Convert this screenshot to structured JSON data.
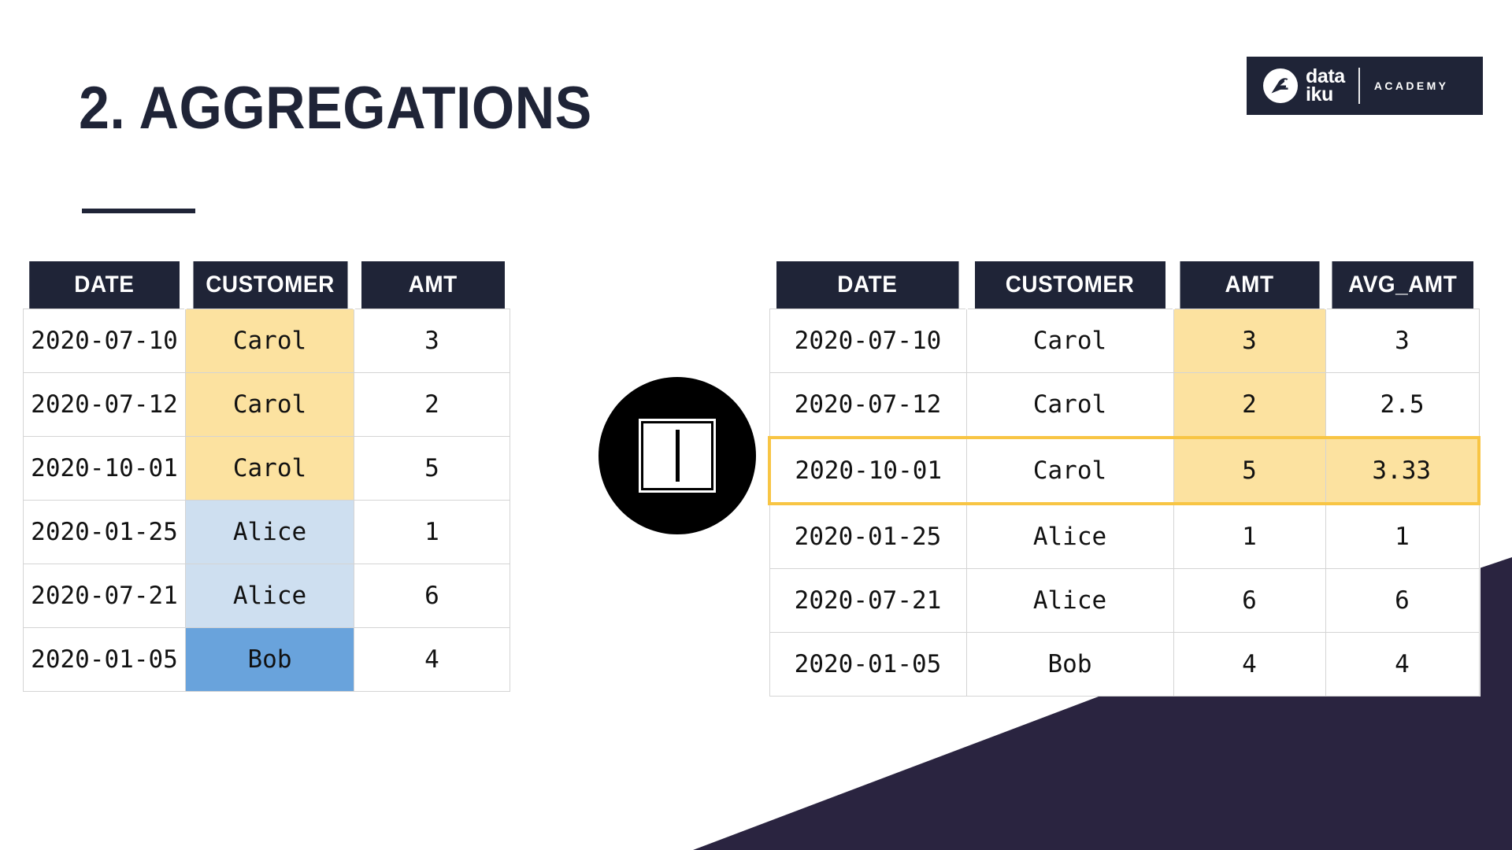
{
  "slide": {
    "title": "2. AGGREGATIONS",
    "background_color": "#FFFFFF"
  },
  "brand": {
    "name_line1": "data",
    "name_line2": "iku",
    "sub_label": "ACADEMY",
    "block_color": "#1F2437",
    "text_color": "#FFFFFF"
  },
  "colors": {
    "navy": "#1F2437",
    "yellow_fill": "#FCE2A0",
    "yellow_outline": "#F8C544",
    "blue_light": "#CEDFF0",
    "blue_mid": "#69A3DC",
    "grid_line": "#D4D4D4",
    "wedge": "#2A2440"
  },
  "center_icon": {
    "semantic": "split-columns-icon",
    "circle_color": "#000000",
    "glyph_color": "#FFFFFF"
  },
  "table_left": {
    "name": "input-table",
    "columns": [
      "DATE",
      "CUSTOMER",
      "AMT"
    ],
    "rows": [
      {
        "cells": [
          "2020-07-10",
          "Carol",
          "3"
        ],
        "fills": [
          "",
          "yellow",
          ""
        ]
      },
      {
        "cells": [
          "2020-07-12",
          "Carol",
          "2"
        ],
        "fills": [
          "",
          "yellow",
          ""
        ]
      },
      {
        "cells": [
          "2020-10-01",
          "Carol",
          "5"
        ],
        "fills": [
          "",
          "yellow",
          ""
        ]
      },
      {
        "cells": [
          "2020-01-25",
          "Alice",
          "1"
        ],
        "fills": [
          "",
          "blue-light",
          ""
        ]
      },
      {
        "cells": [
          "2020-07-21",
          "Alice",
          "6"
        ],
        "fills": [
          "",
          "blue-light",
          ""
        ]
      },
      {
        "cells": [
          "2020-01-05",
          "Bob",
          "4"
        ],
        "fills": [
          "",
          "blue-mid",
          ""
        ]
      }
    ]
  },
  "table_right": {
    "name": "output-table",
    "columns": [
      "DATE",
      "CUSTOMER",
      "AMT",
      "AVG_AMT"
    ],
    "highlight_row_index": 2,
    "rows": [
      {
        "cells": [
          "2020-07-10",
          "Carol",
          "3",
          "3"
        ],
        "fills": [
          "",
          "",
          "yellow",
          ""
        ]
      },
      {
        "cells": [
          "2020-07-12",
          "Carol",
          "2",
          "2.5"
        ],
        "fills": [
          "",
          "",
          "yellow",
          ""
        ]
      },
      {
        "cells": [
          "2020-10-01",
          "Carol",
          "5",
          "3.33"
        ],
        "fills": [
          "",
          "",
          "yellow",
          "yellow"
        ]
      },
      {
        "cells": [
          "2020-01-25",
          "Alice",
          "1",
          "1"
        ],
        "fills": [
          "",
          "",
          "",
          ""
        ]
      },
      {
        "cells": [
          "2020-07-21",
          "Alice",
          "6",
          "6"
        ],
        "fills": [
          "",
          "",
          "",
          ""
        ]
      },
      {
        "cells": [
          "2020-01-05",
          "Bob",
          "4",
          "4"
        ],
        "fills": [
          "",
          "",
          "",
          ""
        ]
      }
    ]
  }
}
